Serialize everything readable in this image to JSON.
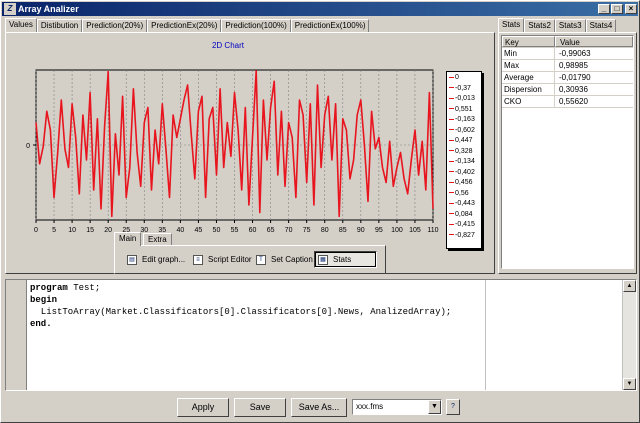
{
  "window": {
    "title": "Array Analizer",
    "minimize": "_",
    "maximize": "□",
    "close": "×"
  },
  "tabs": [
    {
      "label": "Values"
    },
    {
      "label": "Distibution"
    },
    {
      "label": "Prediction(20%)"
    },
    {
      "label": "PredictionEx(20%)"
    },
    {
      "label": "Prediction(100%)"
    },
    {
      "label": "PredictionEx(100%)"
    }
  ],
  "chart_data": {
    "type": "line",
    "title": "2D Chart",
    "xlabel": "",
    "ylabel": "",
    "y_tick_labels": [
      "0"
    ],
    "xlim": [
      0,
      110
    ],
    "ylim": [
      -1,
      1
    ],
    "x_ticks": [
      0,
      5,
      10,
      15,
      20,
      25,
      30,
      35,
      40,
      45,
      50,
      55,
      60,
      65,
      70,
      75,
      80,
      85,
      90,
      95,
      100,
      105,
      110
    ],
    "grid": true,
    "legend_position": "right",
    "series_color": "#e8141e",
    "legend_entries": [
      "0",
      "-0,37",
      "-0,013",
      "0,551",
      "-0,163",
      "-0,602",
      "0,447",
      "0,328",
      "-0,134",
      "-0,402",
      "0,456",
      "0,56",
      "-0,443",
      "0,084",
      "-0,415",
      "-0,827"
    ],
    "series": [
      {
        "values": [
          0.3,
          -0.25,
          -0.02,
          0.45,
          0.2,
          -0.7,
          -0.1,
          0.6,
          -0.05,
          -0.3,
          0.55,
          0.1,
          -0.65,
          0.4,
          -0.2,
          0.7,
          -0.6,
          0.35,
          -0.85,
          0.25,
          0.98,
          -0.95,
          0.15,
          -0.4,
          0.65,
          -0.7,
          -0.3,
          0.75,
          -0.1,
          -0.55,
          0.3,
          0.5,
          -0.6,
          0.2,
          -0.25,
          0.55,
          -0.05,
          -0.7,
          0.4,
          0.1,
          0.35,
          0.6,
          0.8,
          0.15,
          -0.45,
          0.45,
          0.65,
          -0.7,
          0.35,
          0.5,
          -0.4,
          0.75,
          -0.3,
          0.3,
          -0.15,
          0.7,
          0.2,
          -0.6,
          0.5,
          -0.8,
          0.1,
          0.99,
          -0.9,
          0.6,
          -0.2,
          0.5,
          0.85,
          -0.4,
          0.45,
          -0.55,
          0.3,
          0.1,
          -0.7,
          0.6,
          0.4,
          -0.5,
          0.55,
          -0.8,
          0.8,
          -0.3,
          0.4,
          0.65,
          -0.2,
          0.55,
          -0.95,
          0.35,
          0.2,
          -0.45,
          -0.2,
          0.4,
          0.6,
          0.0,
          -0.75,
          0.45,
          -0.05,
          0.1,
          -0.3,
          -0.5,
          0.05,
          -0.55,
          -0.3,
          -0.1,
          -0.45,
          -0.65,
          -0.2,
          0.2,
          -0.4,
          0.05,
          -0.6,
          0.7,
          -0.85
        ]
      }
    ]
  },
  "subtabs": [
    {
      "label": "Main"
    },
    {
      "label": "Extra"
    }
  ],
  "actions": [
    {
      "label": "Edit graph...",
      "icon": "chart-edit-icon"
    },
    {
      "label": "Script Editor",
      "icon": "script-icon"
    },
    {
      "label": "Set Caption",
      "icon": "caption-icon"
    },
    {
      "label": "Stats",
      "icon": "stats-icon"
    }
  ],
  "stats_tabs": [
    {
      "label": "Stats"
    },
    {
      "label": "Stats2"
    },
    {
      "label": "Stats3"
    },
    {
      "label": "Stats4"
    }
  ],
  "stats": {
    "key_header": "Key",
    "value_header": "Value",
    "rows": [
      {
        "key": "Min",
        "value": "-0,99063"
      },
      {
        "key": "Max",
        "value": "0,98985"
      },
      {
        "key": "Average",
        "value": "-0,01790"
      },
      {
        "key": "Dispersion",
        "value": "0,30936"
      },
      {
        "key": "CKO",
        "value": "0,55620"
      }
    ]
  },
  "code": {
    "line1_kw": "program",
    "line1_rest": " Test;",
    "line2_kw": "begin",
    "line3": "  ListToArray(Market.Classificators[0].Classificators[0].News, AnalizedArray);",
    "line4_kw": "end."
  },
  "bottom": {
    "apply": "Apply",
    "save": "Save",
    "save_as": "Save As...",
    "file_select": "xxx.fms",
    "help": "?"
  },
  "colors": {
    "title_start": "#0a246a",
    "title_end": "#3a6ea5",
    "series": "#e8141e",
    "face": "#d4d0c8"
  }
}
